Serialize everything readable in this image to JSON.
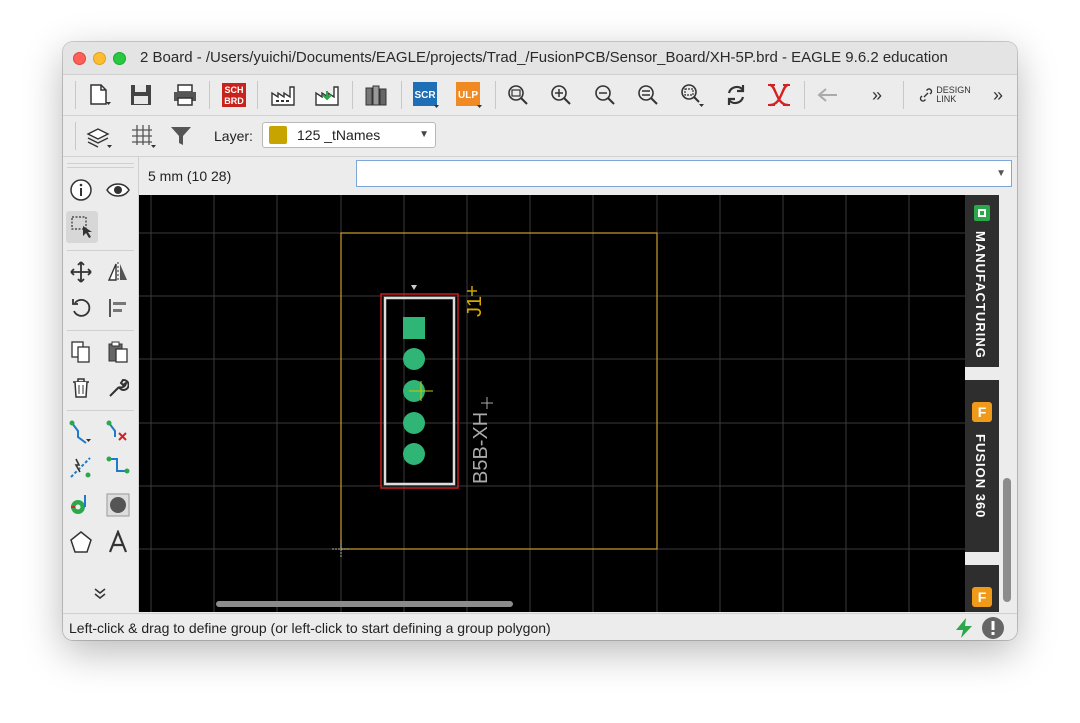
{
  "window": {
    "title": "2 Board - /Users/yuichi/Documents/EAGLE/projects/Trad_/FusionPCB/Sensor_Board/XH-5P.brd - EAGLE 9.6.2 education"
  },
  "toolbar": {
    "sch_brd_label_top": "SCH",
    "sch_brd_label_bottom": "BRD",
    "scr_label": "SCR",
    "ulp_label": "ULP",
    "design_link_top": "DESIGN",
    "design_link_bottom": "LINK",
    "overflow_label": "»"
  },
  "layer_toolbar": {
    "label": "Layer:",
    "selected_layer": "125 _tNames",
    "swatch_color": "#c8a400"
  },
  "command_bar": {
    "coordinate_readout": "5 mm (10 28)",
    "command_value": ""
  },
  "board": {
    "part_name": "J1",
    "part_value": "B5B-XH",
    "pad_color": "#2fb576",
    "outline_color": "#c8a030",
    "package_outline_color": "#c81e1e"
  },
  "side_panel": {
    "manufacturing_label": "MANUFACTURING",
    "fusion_label": "FUSION 360",
    "fusion_icon_letter": "F"
  },
  "status": {
    "message": "Left-click & drag to define group (or left-click to start defining a group polygon)"
  }
}
